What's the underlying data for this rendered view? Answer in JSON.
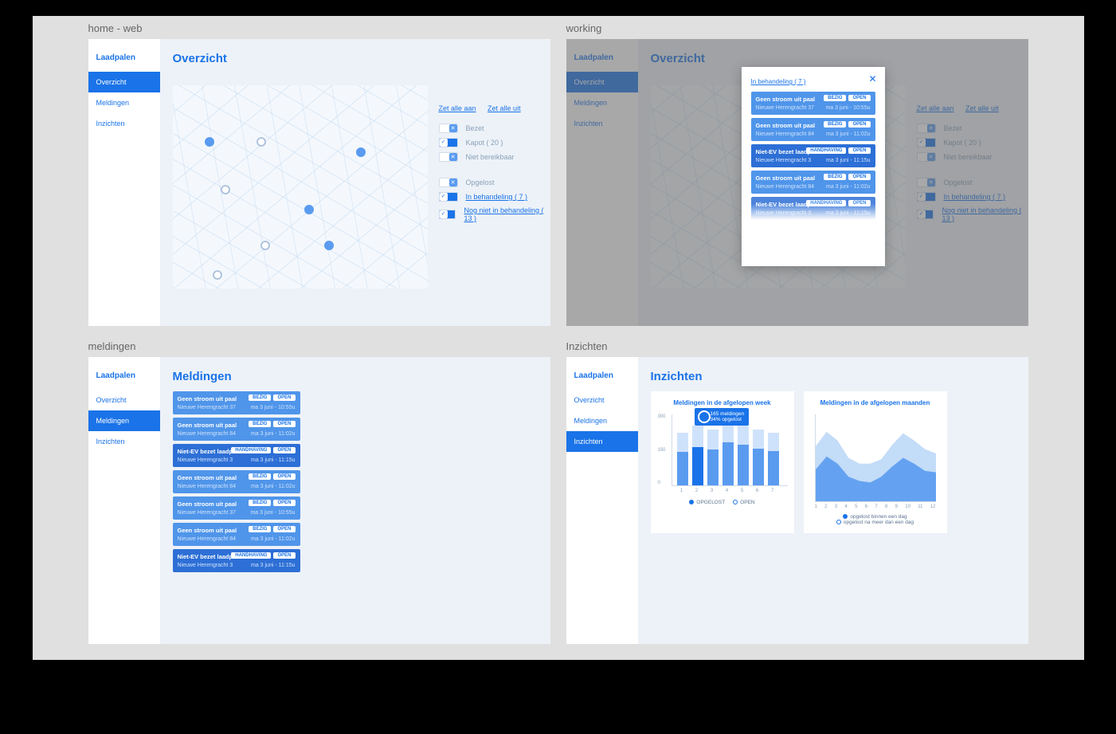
{
  "frames": {
    "home": {
      "title": "home - web"
    },
    "working": {
      "title": "working"
    },
    "meldingen": {
      "title": "meldingen"
    },
    "inzichten": {
      "title": "Inzichten"
    }
  },
  "brand": "Laadpalen",
  "nav": {
    "overzicht": "Overzicht",
    "meldingen": "Meldingen",
    "inzichten": "Inzichten"
  },
  "pages": {
    "overzicht_title": "Overzicht",
    "meldingen_title": "Meldingen",
    "inzichten_title": "Inzichten"
  },
  "bulk": {
    "all_on": "Zet alle aan",
    "all_off": "Zet alle uit"
  },
  "status_group": {
    "bezet": "Bezet",
    "kapot": "Kapot ( 20 )",
    "niet_bereikbaar": "Niet bereikbaar"
  },
  "melding_group": {
    "opgelost": "Opgelost",
    "in_behandeling": "In behandeling ( 7 )",
    "nog_niet": "Nog niet in behandeling ( 13 )"
  },
  "modal": {
    "title": "In behandeling ( 7 )"
  },
  "cards": [
    {
      "title": "Geen stroom uit paal",
      "loc": "Nieuwe Herengracht 37",
      "time": "ma 3 juni - 10:55u",
      "b1": "BEZIG",
      "b2": "OPEN",
      "dark": false
    },
    {
      "title": "Geen stroom uit paal",
      "loc": "Nieuwe Herengracht 84",
      "time": "ma 3 juni - 11:02u",
      "b1": "BEZIG",
      "b2": "OPEN",
      "dark": false
    },
    {
      "title": "Niet-EV bezet laadplek",
      "loc": "Nieuwe Herengracht 3",
      "time": "ma 3 juni - 11:15u",
      "b1": "HANDHAVING",
      "b2": "OPEN",
      "dark": true
    },
    {
      "title": "Geen stroom uit paal",
      "loc": "Nieuwe Herengracht 84",
      "time": "ma 3 juni - 11:02u",
      "b1": "BEZIG",
      "b2": "OPEN",
      "dark": false
    },
    {
      "title": "Niet-EV bezet laadplek",
      "loc": "Nieuwe Herengracht 3",
      "time": "ma 3 juni - 11:15u",
      "b1": "HANDHAVING",
      "b2": "OPEN",
      "dark": true
    }
  ],
  "meld_page_cards": [
    {
      "title": "Geen stroom uit paal",
      "loc": "Nieuwe Herengracht 37",
      "time": "ma 3 juni - 10:55u",
      "b1": "BEZIG",
      "b2": "OPEN",
      "dark": false
    },
    {
      "title": "Geen stroom uit paal",
      "loc": "Nieuwe Herengracht 84",
      "time": "ma 3 juni - 11:02u",
      "b1": "BEZIG",
      "b2": "OPEN",
      "dark": false
    },
    {
      "title": "Niet-EV bezet laadplek",
      "loc": "Nieuwe Herengracht 3",
      "time": "ma 3 juni - 11:15u",
      "b1": "HANDHAVING",
      "b2": "OPEN",
      "dark": true
    },
    {
      "title": "Geen stroom uit paal",
      "loc": "Nieuwe Herengracht 84",
      "time": "ma 3 juni - 11:02u",
      "b1": "BEZIG",
      "b2": "OPEN",
      "dark": false
    },
    {
      "title": "Geen stroom uit paal",
      "loc": "Nieuwe Herengracht 37",
      "time": "ma 3 juni - 10:55u",
      "b1": "BEZIG",
      "b2": "OPEN",
      "dark": false
    },
    {
      "title": "Geen stroom uit paal",
      "loc": "Nieuwe Herengracht 84",
      "time": "ma 3 juni - 11:02u",
      "b1": "BEZIG",
      "b2": "OPEN",
      "dark": false
    },
    {
      "title": "Niet-EV bezet laadplek",
      "loc": "Nieuwe Herengracht 3",
      "time": "ma 3 juni - 11:15u",
      "b1": "HANDHAVING",
      "b2": "OPEN",
      "dark": true
    }
  ],
  "ins": {
    "week_title": "Meldingen in de afgelopen week",
    "months_title": "Meldingen in de afgelopen maanden",
    "tooltip_line1": "165 meldingen",
    "tooltip_line2": "34% opgelost",
    "legend_a": "OPGELOST",
    "legend_b": "OPEN",
    "area_legend_a": "opgelost binnen een dag",
    "area_legend_b": "opgelost na meer dan een dag"
  },
  "chart_data": [
    {
      "type": "bar",
      "title": "Meldingen in de afgelopen week",
      "ylim": [
        0,
        300
      ],
      "yticks": [
        0,
        150,
        300
      ],
      "categories": [
        "1",
        "2",
        "3",
        "4",
        "5",
        "6",
        "7"
      ],
      "series": [
        {
          "name": "OPGELOST",
          "values": [
            140,
            160,
            150,
            180,
            170,
            155,
            145
          ]
        },
        {
          "name": "OPEN",
          "values": [
            80,
            90,
            85,
            95,
            90,
            80,
            75
          ]
        }
      ],
      "tooltip": {
        "index": 1,
        "total": 165,
        "pct_opgelost": 34
      },
      "legend": [
        "OPGELOST",
        "OPEN"
      ]
    },
    {
      "type": "area",
      "title": "Meldingen in de afgelopen maanden",
      "ylim": [
        0,
        600
      ],
      "yticks": [
        100,
        200,
        300,
        400,
        500,
        600
      ],
      "x": [
        1,
        2,
        3,
        4,
        5,
        6,
        7,
        8,
        9,
        10,
        11,
        12
      ],
      "series": [
        {
          "name": "opgelost binnen een dag",
          "values": [
            380,
            480,
            420,
            300,
            260,
            260,
            290,
            390,
            470,
            420,
            360,
            330
          ]
        },
        {
          "name": "opgelost na meer dan een dag",
          "values": [
            220,
            310,
            260,
            170,
            140,
            130,
            170,
            240,
            300,
            260,
            210,
            200
          ]
        }
      ],
      "legend": [
        "opgelost binnen een dag",
        "opgelost na meer dan een dag"
      ]
    }
  ]
}
